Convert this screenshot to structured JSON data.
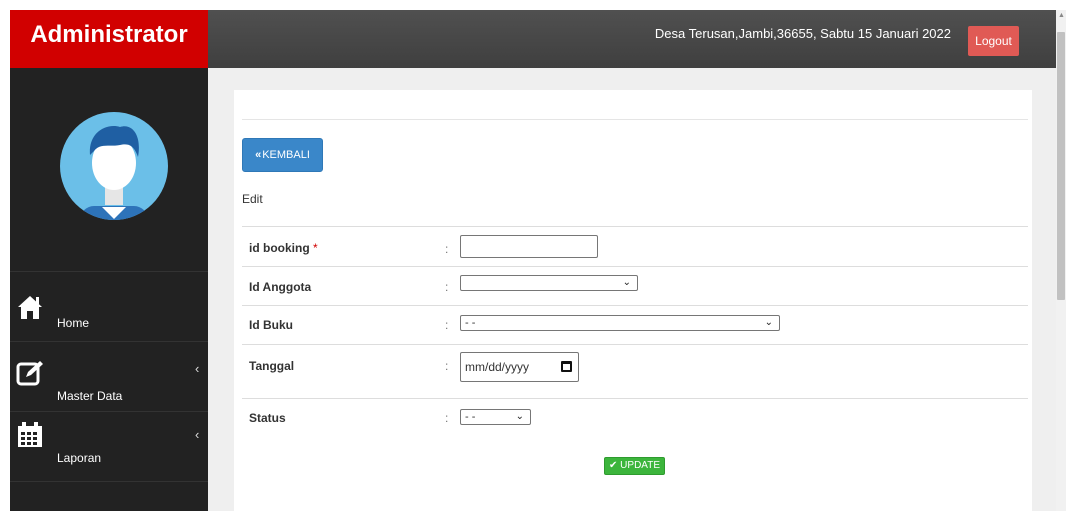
{
  "app": {
    "title": "Administrator"
  },
  "topbar": {
    "info": "Desa Terusan,Jambi,36655, Sabtu 15 Januari 2022",
    "logout_label": "Logout"
  },
  "sidebar": {
    "items": [
      {
        "label": "Home",
        "icon": "home-icon"
      },
      {
        "label": "Master Data",
        "icon": "edit-icon",
        "has_submenu": true
      },
      {
        "label": "Laporan",
        "icon": "calendar-icon",
        "has_submenu": true
      }
    ]
  },
  "main": {
    "back_button": "KEMBALI",
    "section_title": "Edit",
    "fields": {
      "id_booking": {
        "label": "id booking",
        "required_mark": "*",
        "value": ""
      },
      "id_anggota": {
        "label": "Id Anggota",
        "value": ""
      },
      "id_buku": {
        "label": "Id Buku",
        "value": "- -"
      },
      "tanggal": {
        "label": "Tanggal",
        "placeholder": "mm/dd/yyyy"
      },
      "status": {
        "label": "Status",
        "value": "- -"
      }
    },
    "colon": ":",
    "update_button": "UPDATE"
  },
  "colors": {
    "brand": "#d10000",
    "topbar": "#4a4a4a",
    "sidebar": "#222222",
    "primary_button": "#3a87c9",
    "success_button": "#3cb53c",
    "logout_button": "#e05a55"
  }
}
